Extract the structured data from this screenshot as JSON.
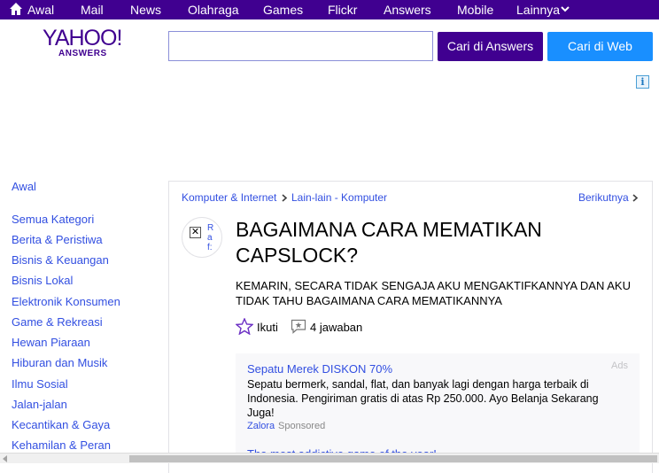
{
  "topnav": {
    "items": [
      {
        "label": "Awal"
      },
      {
        "label": "Mail"
      },
      {
        "label": "News"
      },
      {
        "label": "Olahraga"
      },
      {
        "label": "Games"
      },
      {
        "label": "Flickr"
      },
      {
        "label": "Answers"
      },
      {
        "label": "Mobile"
      },
      {
        "label": "Lainnya"
      }
    ]
  },
  "header": {
    "logo_text": "YAHOO!",
    "logo_sub": "ANSWERS",
    "search_value": "",
    "btn_answers": "Cari di Answers",
    "btn_web": "Cari di Web",
    "ad_info_icon": "i"
  },
  "sidebar": {
    "home": "Awal",
    "items": [
      "Semua Kategori",
      "Berita & Peristiwa",
      "Bisnis & Keuangan",
      "Bisnis Lokal",
      "Elektronik Konsumen",
      "Game & Rekreasi",
      "Hewan Piaraan",
      "Hiburan dan Musik",
      "Ilmu Sosial",
      "Jalan-jalan",
      "Kecantikan & Gaya",
      "Kehamilan & Peran"
    ]
  },
  "breadcrumb": {
    "category": "Komputer & Internet",
    "subcategory": "Lain-lain - Komputer",
    "next": "Berikutnya"
  },
  "question": {
    "avatar_alt": "Raf:",
    "title": "BAGAIMANA CARA MEMATIKAN CAPSLOCK?",
    "body": "KEMARIN, SECARA TIDAK SENGAJA AKU MENGAKTIFKANNYA DAN AKU TIDAK TAHU BAGAIMANA CARA MEMATIKANNYA",
    "follow_label": "Ikuti",
    "answers_label": "4 jawaban"
  },
  "ad": {
    "title": "Sepatu Merek DISKON 70%",
    "label": "Ads",
    "body": "Sepatu bermerk, sandal, flat, dan banyak lagi dengan harga terbaik di Indonesia. Pengiriman gratis di atas Rp 250.000. Ayo Belanja Sekarang Juga!",
    "source": "Zalora",
    "sponsored": "Sponsored",
    "next_title": "The most addictive game of the year!"
  },
  "colors": {
    "brand_purple": "#400090",
    "web_blue": "#198fff",
    "link_blue": "#324fe1"
  },
  "icons": {
    "home": "home-icon",
    "chevron": "chevron-down-icon",
    "star": "star-outline-icon",
    "answers": "answer-bubble-icon",
    "broken_image": "broken-image-icon"
  }
}
